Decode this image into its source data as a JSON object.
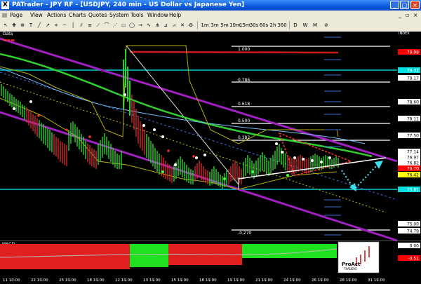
{
  "window": {
    "title": "PATrader - JPY RF - [USDJPY, 240 min - US Dollar vs Japanese Yen]"
  },
  "menu": [
    "Page",
    "View",
    "Actions",
    "Charts",
    "Quotes",
    "System",
    "Tools",
    "Window",
    "Help"
  ],
  "toolbar": {
    "timeframes": [
      "1m",
      "3m",
      "5m",
      "10m",
      "15m",
      "30s",
      "60s",
      "2h",
      "360",
      "D",
      "W",
      "M"
    ]
  },
  "chart": {
    "data_label": "Data",
    "index_label": "INDEX",
    "macd_label": "MACD",
    "fib_levels": [
      "1.000",
      "0.786",
      "0.618",
      "0.500",
      "0.382",
      "-0.270"
    ],
    "price_labels": [
      {
        "text": "79.99",
        "bg": "#ff0000",
        "fg": "#ffffff"
      },
      {
        "text": "79.32",
        "bg": "#00e0e0",
        "fg": "#ffffff"
      },
      {
        "text": "79.17",
        "bg": "#ffffff",
        "fg": "#000000"
      },
      {
        "text": "78.60",
        "bg": "#ffffff",
        "fg": "#000000"
      },
      {
        "text": "78.11",
        "bg": "#ffffff",
        "fg": "#000000"
      },
      {
        "text": "77.50",
        "bg": "#ffffff",
        "fg": "#000000"
      },
      {
        "text": "77.14",
        "bg": "#ffffff",
        "fg": "#000000"
      },
      {
        "text": "76.97",
        "bg": "#ffffff",
        "fg": "#000000"
      },
      {
        "text": "76.82",
        "bg": "#ffffff",
        "fg": "#000000"
      },
      {
        "text": "76.70",
        "bg": "#ff0000",
        "fg": "#ffffff"
      },
      {
        "text": "76.42",
        "bg": "#ffff00",
        "fg": "#000000"
      },
      {
        "text": "75.81",
        "bg": "#00e0e0",
        "fg": "#ffffff"
      },
      {
        "text": "75.00",
        "bg": "#ffffff",
        "fg": "#000000"
      },
      {
        "text": "74.79",
        "bg": "#ffffff",
        "fg": "#000000"
      },
      {
        "text": "0.00",
        "bg": "#ffffff",
        "fg": "#000000"
      },
      {
        "text": "-0.51",
        "bg": "#ff0000",
        "fg": "#ffffff"
      }
    ],
    "time_labels": [
      "11 10:00",
      "22 19:00",
      "25 19:00",
      "18 19:00",
      "12 19:00",
      "13 19:00",
      "15 19:00",
      "18 19:00",
      "19 19:00",
      "21 19:00",
      "24 19:00",
      "26 19:00",
      "28 19:00",
      "31 19:00"
    ],
    "logo": {
      "line1": "ProAct",
      "line2": "TRADERS"
    }
  }
}
